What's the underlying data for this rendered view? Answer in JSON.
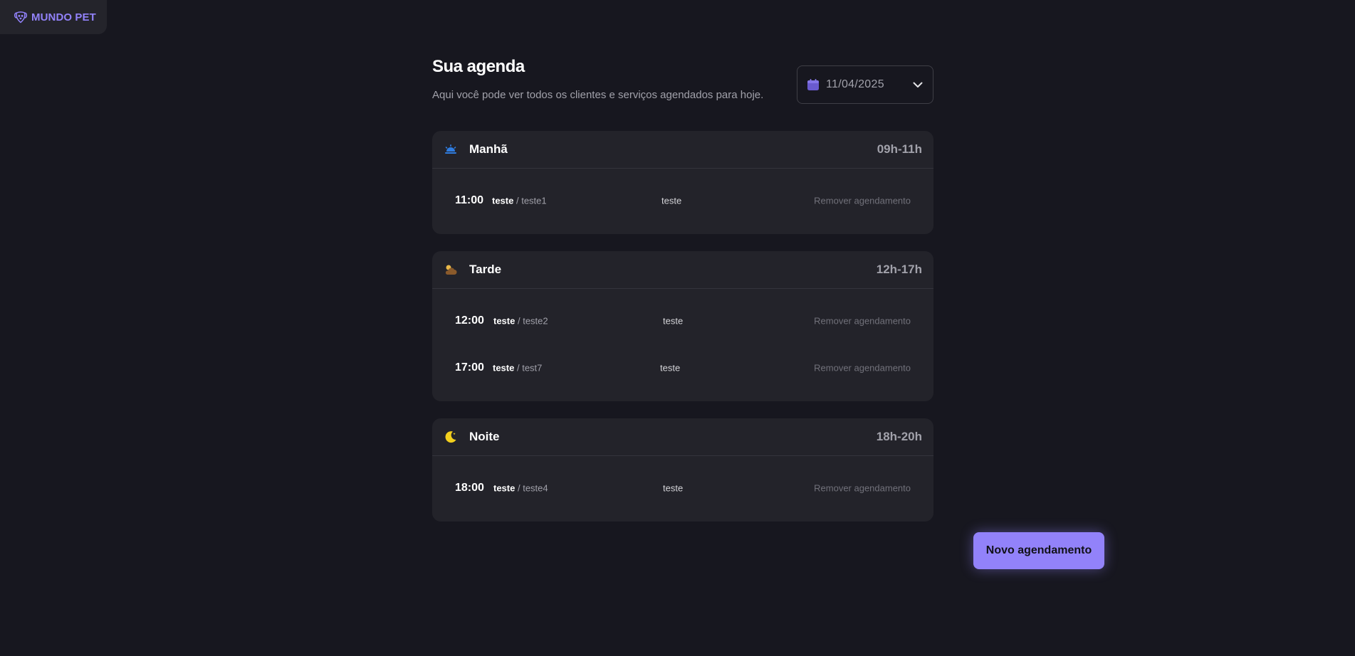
{
  "brand": {
    "name": "MUNDO PET",
    "accent_color": "#9282fa"
  },
  "header": {
    "title": "Sua agenda",
    "subtitle": "Aqui você pode ver todos os clientes e serviços agendados para hoje.",
    "date": "11/04/2025",
    "date_icon": "calendar-icon",
    "dropdown_icon": "chevron-down-icon"
  },
  "periods": [
    {
      "name": "Manhã",
      "range": "09h-11h",
      "icon": "sunrise-icon",
      "appointments": [
        {
          "time": "11:00",
          "pet": "teste",
          "owner": "/ teste1",
          "service": "teste",
          "remove_label": "Remover agendamento"
        }
      ]
    },
    {
      "name": "Tarde",
      "range": "12h-17h",
      "icon": "cloud-sun-icon",
      "appointments": [
        {
          "time": "12:00",
          "pet": "teste",
          "owner": "/ teste2",
          "service": "teste",
          "remove_label": "Remover agendamento"
        },
        {
          "time": "17:00",
          "pet": "teste",
          "owner": "/ test7",
          "service": "teste",
          "remove_label": "Remover agendamento"
        }
      ]
    },
    {
      "name": "Noite",
      "range": "18h-20h",
      "icon": "moon-icon",
      "appointments": [
        {
          "time": "18:00",
          "pet": "teste",
          "owner": "/ teste4",
          "service": "teste",
          "remove_label": "Remover agendamento"
        }
      ]
    }
  ],
  "actions": {
    "new_appointment_label": "Novo agendamento"
  }
}
